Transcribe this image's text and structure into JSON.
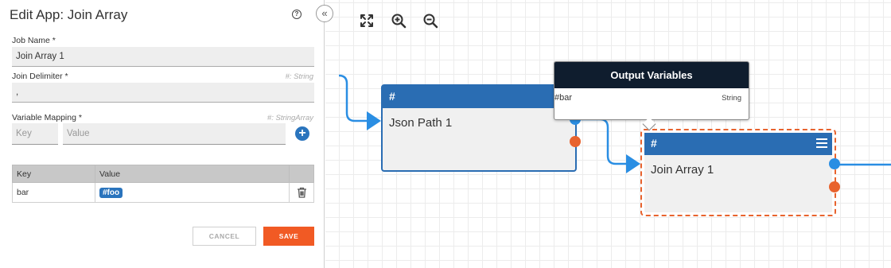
{
  "panel": {
    "title": "Edit App: Join Array",
    "help_icon": "?",
    "collapse_icon": "«",
    "job_name": {
      "label": "Job Name *",
      "value": "Join Array 1"
    },
    "join_delimiter": {
      "label": "Join Delimiter *",
      "hint": "#: String",
      "value": ","
    },
    "variable_mapping": {
      "label": "Variable Mapping *",
      "hint": "#: StringArray",
      "key_placeholder": "Key",
      "value_placeholder": "Value",
      "add_icon": "+"
    },
    "table": {
      "headers": [
        "Key",
        "Value",
        ""
      ],
      "rows": [
        {
          "key": "bar",
          "value": "#foo"
        }
      ]
    },
    "cancel_label": "CANCEL",
    "save_label": "SAVE"
  },
  "canvas": {
    "toolbar": [
      "fit-screen-icon",
      "zoom-in-icon",
      "zoom-out-icon"
    ],
    "nodes": [
      {
        "header": "#",
        "title": "Json Path 1"
      },
      {
        "header": "#",
        "title": "Join Array 1"
      }
    ],
    "tooltip": {
      "title": "Output Variables",
      "variable": "#bar",
      "type": "String"
    }
  },
  "colors": {
    "primary_blue": "#2a6db3",
    "port_blue": "#2a8ee3",
    "port_orange": "#e8632e",
    "save_orange": "#f15a24",
    "tooltip_dark": "#0f1d2e"
  }
}
